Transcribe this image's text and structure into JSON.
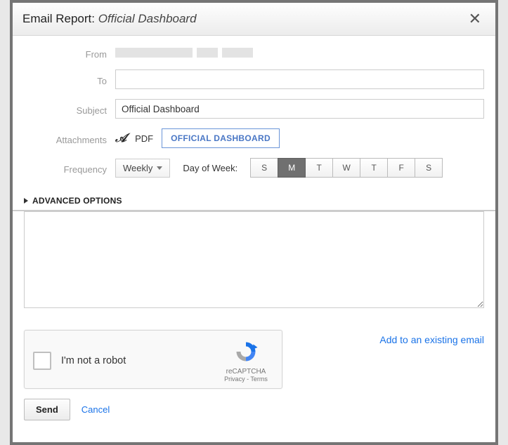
{
  "dialog": {
    "title_prefix": "Email Report: ",
    "title_name": "Official Dashboard"
  },
  "form": {
    "from_label": "From",
    "to_label": "To",
    "to_value": "",
    "subject_label": "Subject",
    "subject_value": "Official Dashboard",
    "attachments_label": "Attachments",
    "attachment_format": "PDF",
    "attachment_chip": "OFFICIAL DASHBOARD",
    "frequency_label": "Frequency",
    "frequency_value": "Weekly",
    "dow_label": "Day of Week:",
    "days": [
      "S",
      "M",
      "T",
      "W",
      "T",
      "F",
      "S"
    ],
    "active_day_index": 1
  },
  "advanced_label": "ADVANCED OPTIONS",
  "message_value": "",
  "recaptcha": {
    "label": "I'm not a robot",
    "brand": "reCAPTCHA",
    "privacy": "Privacy",
    "terms": "Terms",
    "sep": " - "
  },
  "footer": {
    "add_existing": "Add to an existing email",
    "send": "Send",
    "cancel": "Cancel"
  }
}
